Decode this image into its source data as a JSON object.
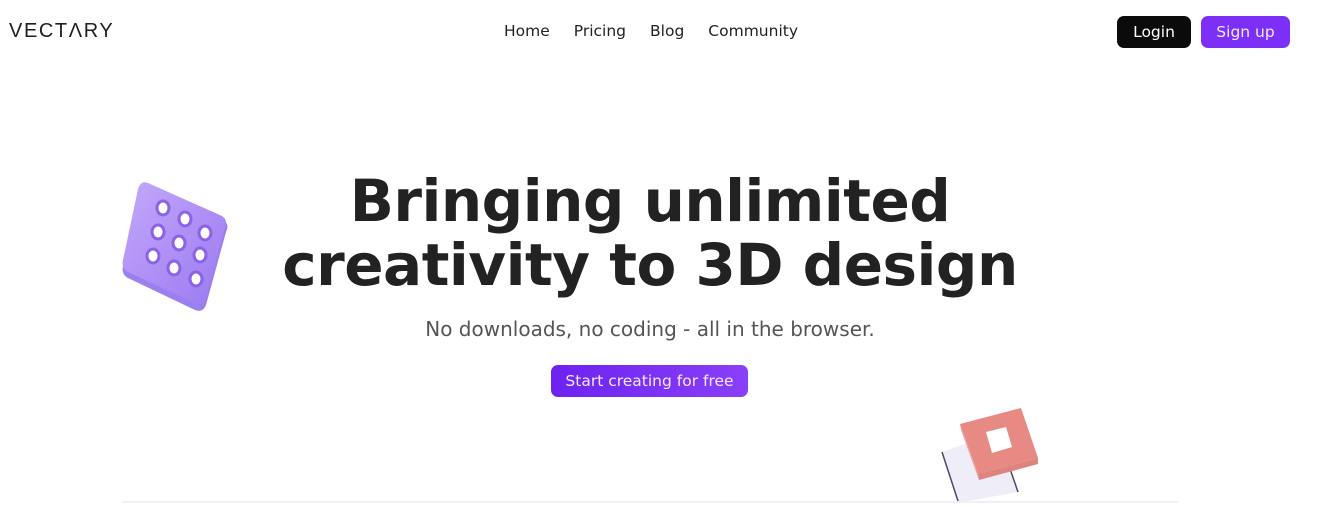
{
  "header": {
    "logo": "VECTΛRY",
    "nav": [
      {
        "label": "Home"
      },
      {
        "label": "Pricing"
      },
      {
        "label": "Blog"
      },
      {
        "label": "Community"
      }
    ],
    "login_label": "Login",
    "signup_label": "Sign up"
  },
  "hero": {
    "title_line1": "Bringing unlimited",
    "title_line2": "creativity to 3D design",
    "subtitle": "No downloads, no coding - all in the browser.",
    "cta_label": "Start creating for free"
  },
  "colors": {
    "accent": "#7b2ff7",
    "login_bg": "#0b0b0b",
    "title": "#222222"
  },
  "decorations": [
    "purple-grid-tile-3d-icon",
    "coral-square-frame-3d-icon"
  ]
}
